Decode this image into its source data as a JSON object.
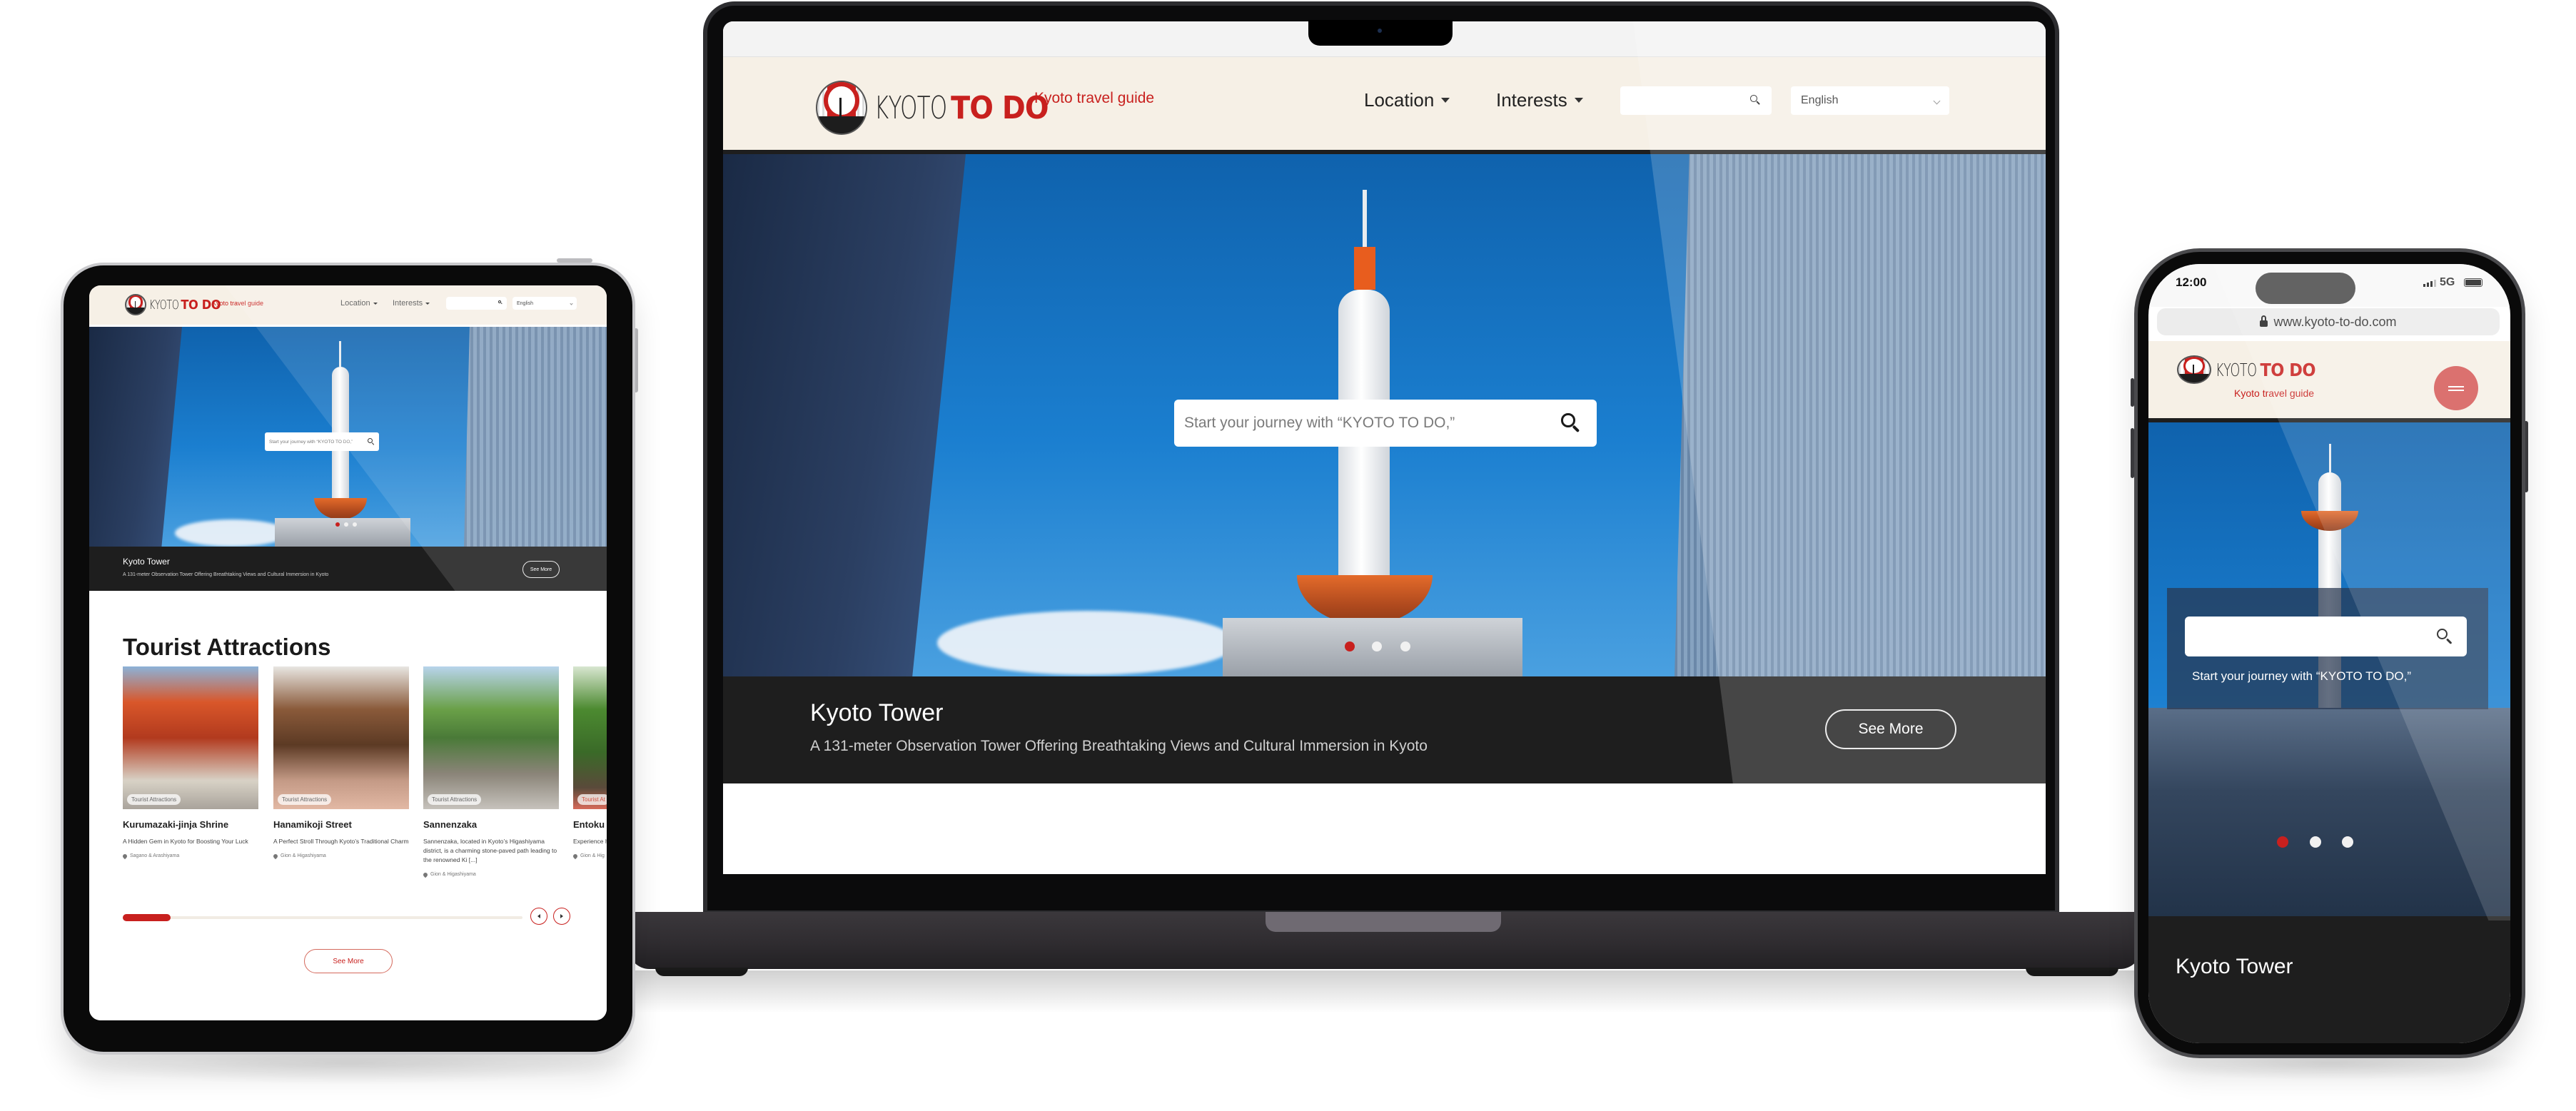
{
  "site": {
    "brand_primary": "KYOTO",
    "brand_accent": "TO DO",
    "tagline": "Kyoto travel guide",
    "url": "www.kyoto-to-do.com",
    "accent_color": "#c8201e",
    "header_bg": "#f6f0e6",
    "caption_bg": "#1e1e1e"
  },
  "nav": {
    "location": "Location",
    "interests": "Interests",
    "language": "English",
    "search_icon": "search-icon"
  },
  "hero": {
    "search_placeholder": "Start your journey with “KYOTO TO DO,”",
    "slide_count": 3,
    "active_slide": 1,
    "title": "Kyoto Tower",
    "subtitle": "A 131-meter Observation Tower Offering Breathtaking Views and Cultural Immersion in Kyoto",
    "see_more": "See More"
  },
  "tablet": {
    "section_title": "Tourist Attractions",
    "cards": [
      {
        "badge": "Tourist Attractions",
        "name": "Kurumazaki-jinja Shrine",
        "desc": "A Hidden Gem in Kyoto for Boosting Your Luck",
        "location": "Sagano & Arashiyama"
      },
      {
        "badge": "Tourist Attractions",
        "name": "Hanamikoji Street",
        "desc": "A Perfect Stroll Through Kyoto’s Traditional Charm",
        "location": "Gion & Higashiyama"
      },
      {
        "badge": "Tourist Attractions",
        "name": "Sannenzaka",
        "desc": "Sannenzaka, located in Kyoto’s Higashiyama district, is a charming stone-paved path leading to the renowned Ki [...]",
        "location": "Gion & Higashiyama"
      },
      {
        "badge": "Tourist At",
        "name": "Entoku",
        "desc": "Experience hidden ge",
        "location": "Gion & Hig"
      }
    ],
    "carousel_progress_fraction": 0.12,
    "prev_icon": "chevron-left-icon",
    "next_icon": "chevron-right-icon",
    "see_more": "See More"
  },
  "phone": {
    "time": "12:00",
    "network": "5G",
    "menu_icon": "hamburger-menu-icon"
  }
}
